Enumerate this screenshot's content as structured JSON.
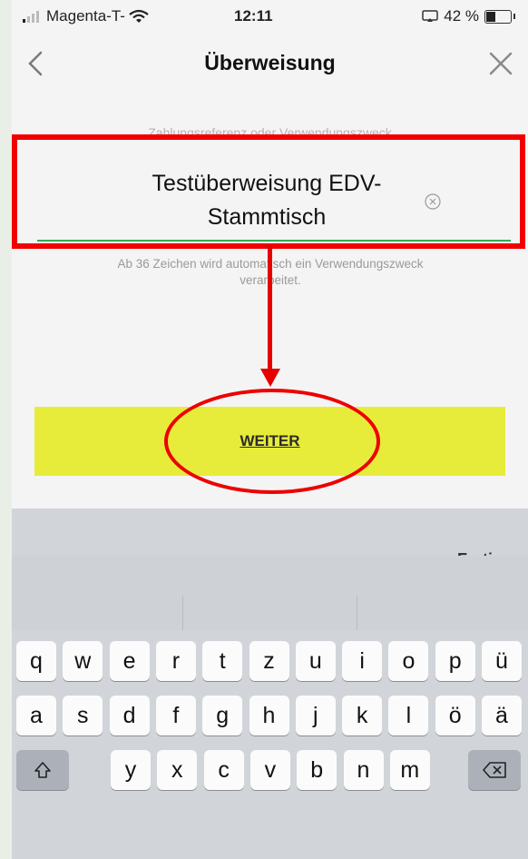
{
  "status": {
    "carrier": "Magenta-T-",
    "time": "12:11",
    "battery": "42 %"
  },
  "nav": {
    "title": "Überweisung"
  },
  "field": {
    "label": "Zahlungsreferenz oder Verwendungszweck",
    "value_line1": "Testüberweisung EDV-",
    "value_line2": "Stammtisch",
    "hint_line1": "Ab 36 Zeichen wird automatisch ein Verwendungszweck",
    "hint_line2": "verarbeitet."
  },
  "button": {
    "label": "WEITER"
  },
  "keyboard": {
    "done_label": "Fertig",
    "row1": [
      "q",
      "w",
      "e",
      "r",
      "t",
      "z",
      "u",
      "i",
      "o",
      "p",
      "ü"
    ],
    "row2": [
      "a",
      "s",
      "d",
      "f",
      "g",
      "h",
      "j",
      "k",
      "l",
      "ö",
      "ä"
    ],
    "row3": [
      "y",
      "x",
      "c",
      "v",
      "b",
      "n",
      "m"
    ]
  },
  "colors": {
    "accent_button": "#e7ec3a",
    "annotation_red": "#f20000",
    "underline_green": "#3aa556"
  }
}
